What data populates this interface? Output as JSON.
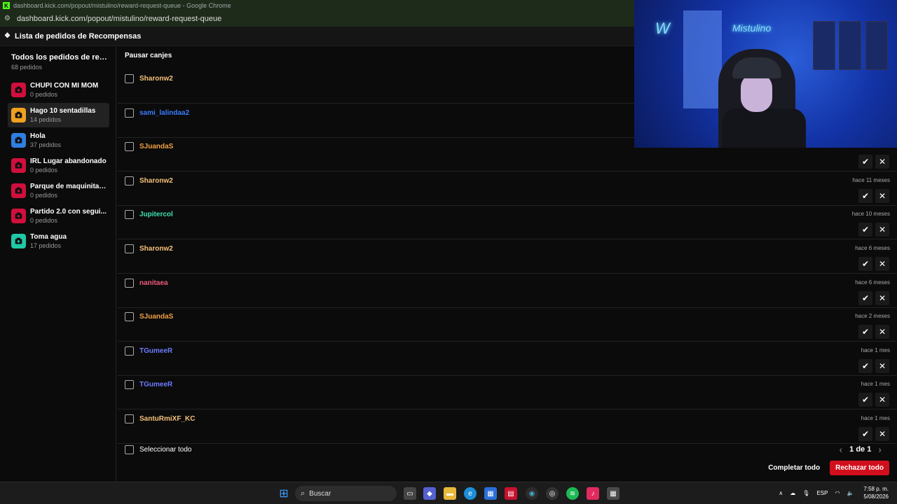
{
  "browser": {
    "window_title": "dashboard.kick.com/popout/mistulino/reward-request-queue - Google Chrome",
    "url": "dashboard.kick.com/popout/mistulino/reward-request-queue"
  },
  "page": {
    "title": "Lista de pedidos de Recompensas"
  },
  "sidebar": {
    "all": {
      "label": "Todos los pedidos de reco...",
      "count": "68 pedidos"
    },
    "items": [
      {
        "label": "CHUPI CON MI MOM",
        "count": "0 pedidos",
        "color": "#d10f3c"
      },
      {
        "label": "Hago 10 sentadillas",
        "count": "14 pedidos",
        "color": "#f0a020"
      },
      {
        "label": "Hola",
        "count": "37 pedidos",
        "color": "#2f7fe0"
      },
      {
        "label": "IRL Lugar abandonado",
        "count": "0 pedidos",
        "color": "#d10f3c"
      },
      {
        "label": "Parque de maquinitas...",
        "count": "0 pedidos",
        "color": "#d10f3c"
      },
      {
        "label": "Partido 2.0 con segui...",
        "count": "0 pedidos",
        "color": "#d10f3c"
      },
      {
        "label": "Toma agua",
        "count": "17 pedidos",
        "color": "#1fc9a6"
      }
    ]
  },
  "main": {
    "pause_label": "Pausar canjes",
    "rows": [
      {
        "user": "Sharonw2",
        "color": "#f5c07a",
        "time": ""
      },
      {
        "user": "sami_lalindaa2",
        "color": "#3a7bff",
        "time": ""
      },
      {
        "user": "SJuandaS",
        "color": "#f0a040",
        "time": ""
      },
      {
        "user": "Sharonw2",
        "color": "#f5c07a",
        "time": "hace 11 meses"
      },
      {
        "user": "Jupitercol",
        "color": "#3fe0b0",
        "time": "hace 10 meses"
      },
      {
        "user": "Sharonw2",
        "color": "#f5c07a",
        "time": "hace 6 meses"
      },
      {
        "user": "nanitaea",
        "color": "#f05a7a",
        "time": "hace 6 meses"
      },
      {
        "user": "SJuandaS",
        "color": "#f0a040",
        "time": "hace 2 meses"
      },
      {
        "user": "TGumeeR",
        "color": "#6a7cff",
        "time": "hace 1 mes"
      },
      {
        "user": "TGumeeR",
        "color": "#6a7cff",
        "time": "hace 1 mes"
      },
      {
        "user": "SantuRmiXF_KC",
        "color": "#f5c07a",
        "time": "hace 1 mes"
      }
    ],
    "select_all": "Seleccionar todo",
    "pager": "1 de 1",
    "complete_all": "Completar todo",
    "reject_all": "Rechazar todo"
  },
  "taskbar": {
    "search_placeholder": "Buscar",
    "lang": "ESP",
    "time": "7:58 p. m.",
    "date": "5/08/2026"
  },
  "webcam": {
    "neon_text": "Mistulino"
  }
}
